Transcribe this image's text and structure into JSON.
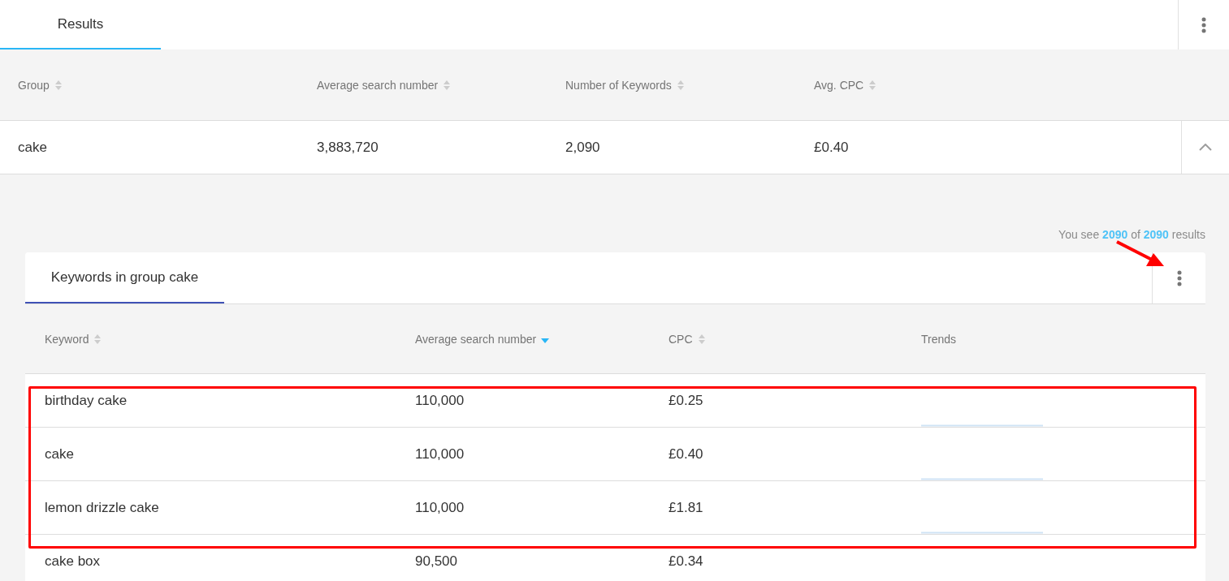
{
  "top_tabs": [
    {
      "label": "Results",
      "selected": true
    }
  ],
  "groups_table": {
    "columns": [
      {
        "label": "Group",
        "sortable": true,
        "sorted_descending": false
      },
      {
        "label": "Average search number",
        "sortable": true,
        "sorted_descending": false
      },
      {
        "label": "Number of Keywords",
        "sortable": true,
        "sorted_descending": false
      },
      {
        "label": "Avg. CPC",
        "sortable": true,
        "sorted_descending": false
      }
    ],
    "rows": [
      {
        "cells": [
          "cake",
          "3,883,720",
          "2,090",
          "£0.40"
        ],
        "expanded": true
      }
    ]
  },
  "results_summary": "You see **2090** of  **2090** results",
  "keywords_card": {
    "tabs": [
      {
        "label": "Keywords in group cake",
        "selected": true
      }
    ],
    "columns": [
      {
        "label": "Keyword",
        "sortable": true,
        "sorted_descending": false
      },
      {
        "label": "Average search number",
        "sortable": true,
        "sorted_descending": true
      },
      {
        "label": "CPC",
        "sortable": true,
        "sorted_descending": false
      },
      {
        "label": "Trends"
      }
    ],
    "rows": [
      {
        "cells": [
          "birthday cake",
          "110,000",
          "£0.25"
        ]
      },
      {
        "cells": [
          "cake",
          "110,000",
          "£0.40"
        ]
      },
      {
        "cells": [
          "lemon drizzle cake",
          "110,000",
          "£1.81"
        ]
      },
      {
        "cells": [
          "cake box",
          "90,500",
          "£0.34"
        ]
      }
    ]
  },
  "annotations": {
    "highlight_frame": true,
    "arrow": true
  }
}
